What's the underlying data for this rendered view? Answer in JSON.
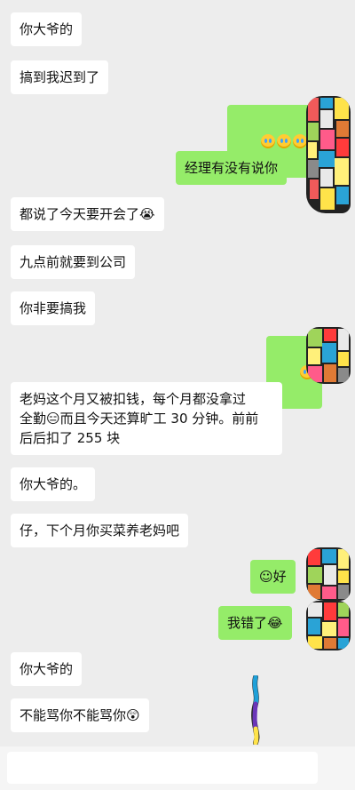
{
  "messages": [
    {
      "side": "left",
      "text": "你大爷的"
    },
    {
      "side": "left",
      "text": "搞到我迟到了"
    },
    {
      "side": "right",
      "text": "😂😂😂"
    },
    {
      "side": "right",
      "text": "经理有没有说你"
    },
    {
      "side": "left",
      "text": "都说了今天要开会了😭"
    },
    {
      "side": "left",
      "text": "九点前就要到公司"
    },
    {
      "side": "left",
      "text": "你非要搞我"
    },
    {
      "side": "right",
      "text": "😂"
    },
    {
      "side": "left",
      "text": "老妈这个月又被扣钱，每个月都没拿过\n全勤😑而且今天还算旷工 30 分钟。前前\n后后扣了 255 块"
    },
    {
      "side": "left",
      "text": "你大爷的。"
    },
    {
      "side": "left",
      "text": "仔，下个月你买菜养老妈吧"
    },
    {
      "side": "right",
      "text": "☺好"
    },
    {
      "side": "right",
      "text": "我错了😂"
    },
    {
      "side": "left",
      "text": "你大爷的"
    },
    {
      "side": "left",
      "text": "不能骂你不能骂你😲"
    }
  ],
  "colors": {
    "background": "#ededed",
    "left_bubble": "#ffffff",
    "right_bubble": "#95ec69"
  },
  "icons": {
    "avatar": "mosaic-avatar-icon",
    "emoji_laugh": "laugh-cry-emoji",
    "emoji_cry": "crying-emoji",
    "emoji_smile": "smile-emoji",
    "emoji_shock": "shock-emoji"
  }
}
